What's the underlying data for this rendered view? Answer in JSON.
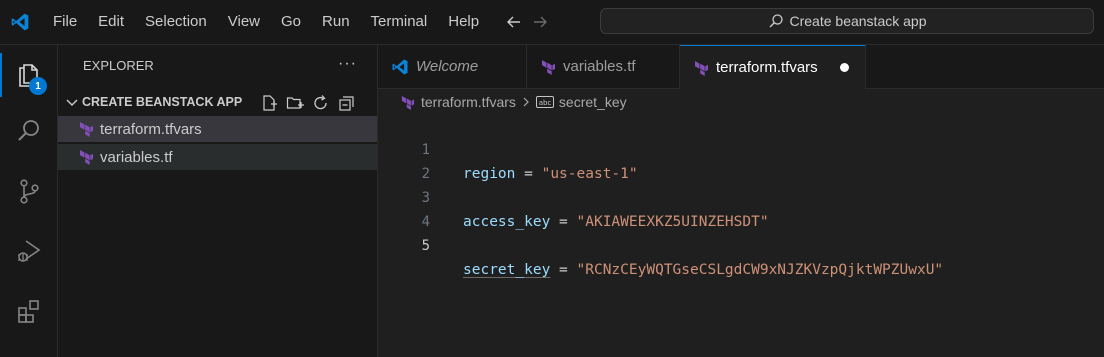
{
  "menu": [
    "File",
    "Edit",
    "Selection",
    "View",
    "Go",
    "Run",
    "Terminal",
    "Help"
  ],
  "command_center": {
    "text": "Create beanstack app"
  },
  "activity_bar": {
    "explorer_badge": "1"
  },
  "sidebar": {
    "title": "EXPLORER",
    "more": "···",
    "section": "CREATE BEANSTACK APP",
    "files": [
      {
        "name": "terraform.tfvars"
      },
      {
        "name": "variables.tf"
      }
    ]
  },
  "tabs": [
    {
      "label": "Welcome"
    },
    {
      "label": "variables.tf"
    },
    {
      "label": "terraform.tfvars"
    }
  ],
  "breadcrumb": {
    "file": "terraform.tfvars",
    "symbol": "secret_key"
  },
  "editor": {
    "lines": [
      {
        "num": "1",
        "key": "region",
        "eq": "=",
        "value": "\"us-east-1\""
      },
      {
        "num": "2",
        "key": "",
        "eq": "",
        "value": ""
      },
      {
        "num": "3",
        "key": "access_key",
        "eq": "=",
        "value": "\"AKIAWEEXKZ5UINZEHSDT\""
      },
      {
        "num": "4",
        "key": "",
        "eq": "",
        "value": ""
      },
      {
        "num": "5",
        "key": "secret_key",
        "eq": "=",
        "value": "\"RCNzCEyWQTGseCSLgdCW9xNJZKVzpQjktWPZUwxU\""
      }
    ]
  },
  "colors": {
    "accent": "#0078d4",
    "terraform": "#844fba",
    "string": "#ce9178",
    "key": "#9cdcfe"
  }
}
